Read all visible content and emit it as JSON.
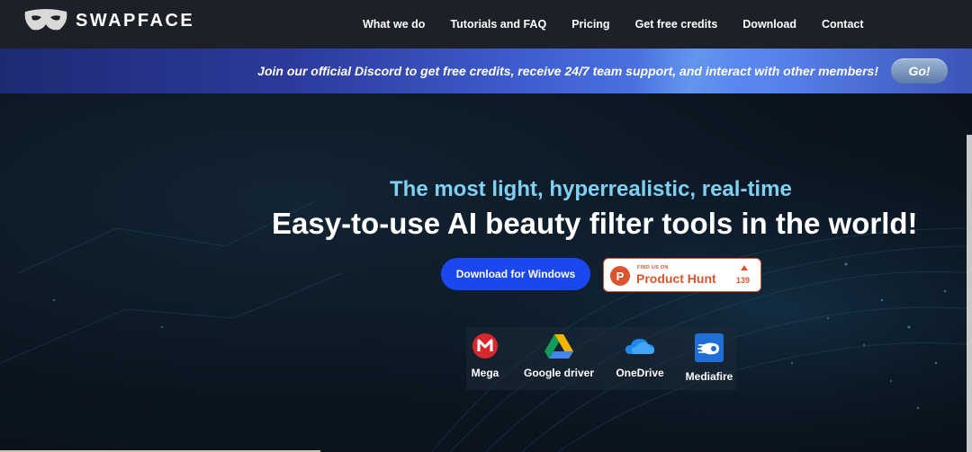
{
  "brand": {
    "name": "SWAPFACE",
    "logo_icon": "mask-icon"
  },
  "nav": {
    "links": [
      "What we do",
      "Tutorials and FAQ",
      "Pricing",
      "Get free credits",
      "Download",
      "Contact"
    ]
  },
  "banner": {
    "text": "Join our official Discord to get free credits, receive 24/7 team support, and interact with other members!",
    "button_label": "Go!"
  },
  "hero": {
    "subtitle": "The most light, hyperrealistic, real-time",
    "headline": "Easy-to-use AI beauty filter tools in the world!",
    "download_button": "Download for Windows",
    "product_hunt": {
      "caption": "FIND US ON",
      "name": "Product Hunt",
      "logo_letter": "P",
      "upvotes": "139"
    }
  },
  "mirrors": [
    {
      "label": "Mega",
      "icon": "mega-icon"
    },
    {
      "label": "Google driver",
      "icon": "google-drive-icon"
    },
    {
      "label": "OneDrive",
      "icon": "onedrive-icon"
    },
    {
      "label": "Mediafire",
      "icon": "mediafire-icon"
    }
  ],
  "colors": {
    "accent_blue": "#1a47f0",
    "subtitle_cyan": "#7fd0f2",
    "product_hunt_orange": "#da552f",
    "nav_bg": "#1d2026"
  }
}
